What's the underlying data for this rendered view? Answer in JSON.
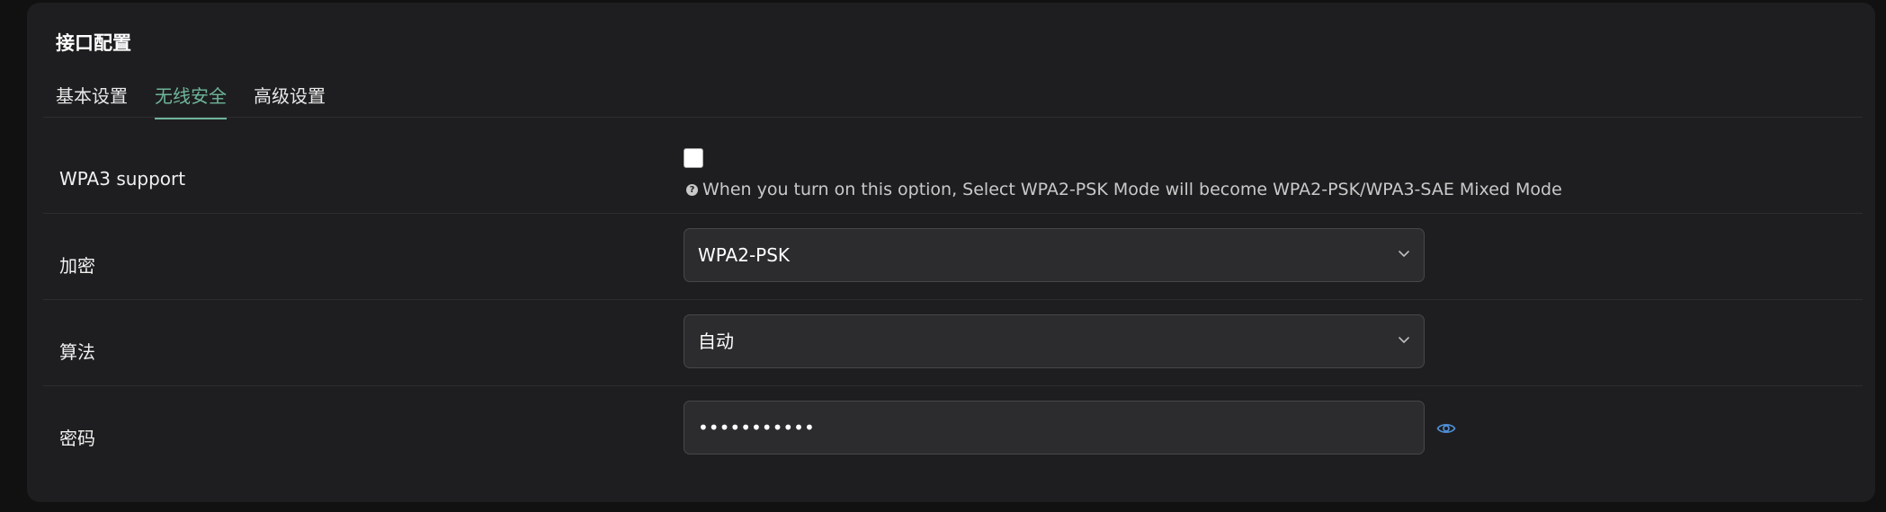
{
  "panel": {
    "title": "接口配置",
    "tabs": [
      {
        "label": "基本设置",
        "active": false
      },
      {
        "label": "无线安全",
        "active": true
      },
      {
        "label": "高级设置",
        "active": false
      }
    ]
  },
  "form": {
    "wpa3": {
      "label": "WPA3 support",
      "checked": false,
      "help": "When you turn on this option, Select WPA2-PSK Mode will become WPA2-PSK/WPA3-SAE Mixed Mode"
    },
    "encryption": {
      "label": "加密",
      "value": "WPA2-PSK"
    },
    "algorithm": {
      "label": "算法",
      "value": "自动"
    },
    "password": {
      "label": "密码",
      "value": "•••••••••••"
    }
  },
  "icons": {
    "help": "question-circle-icon",
    "chevron": "chevron-down-icon",
    "reveal": "eye-icon"
  },
  "colors": {
    "accent": "#6fb59a",
    "eye": "#4f8fd6",
    "panel_bg": "#1e1e20",
    "field_bg": "#2c2c2e"
  }
}
